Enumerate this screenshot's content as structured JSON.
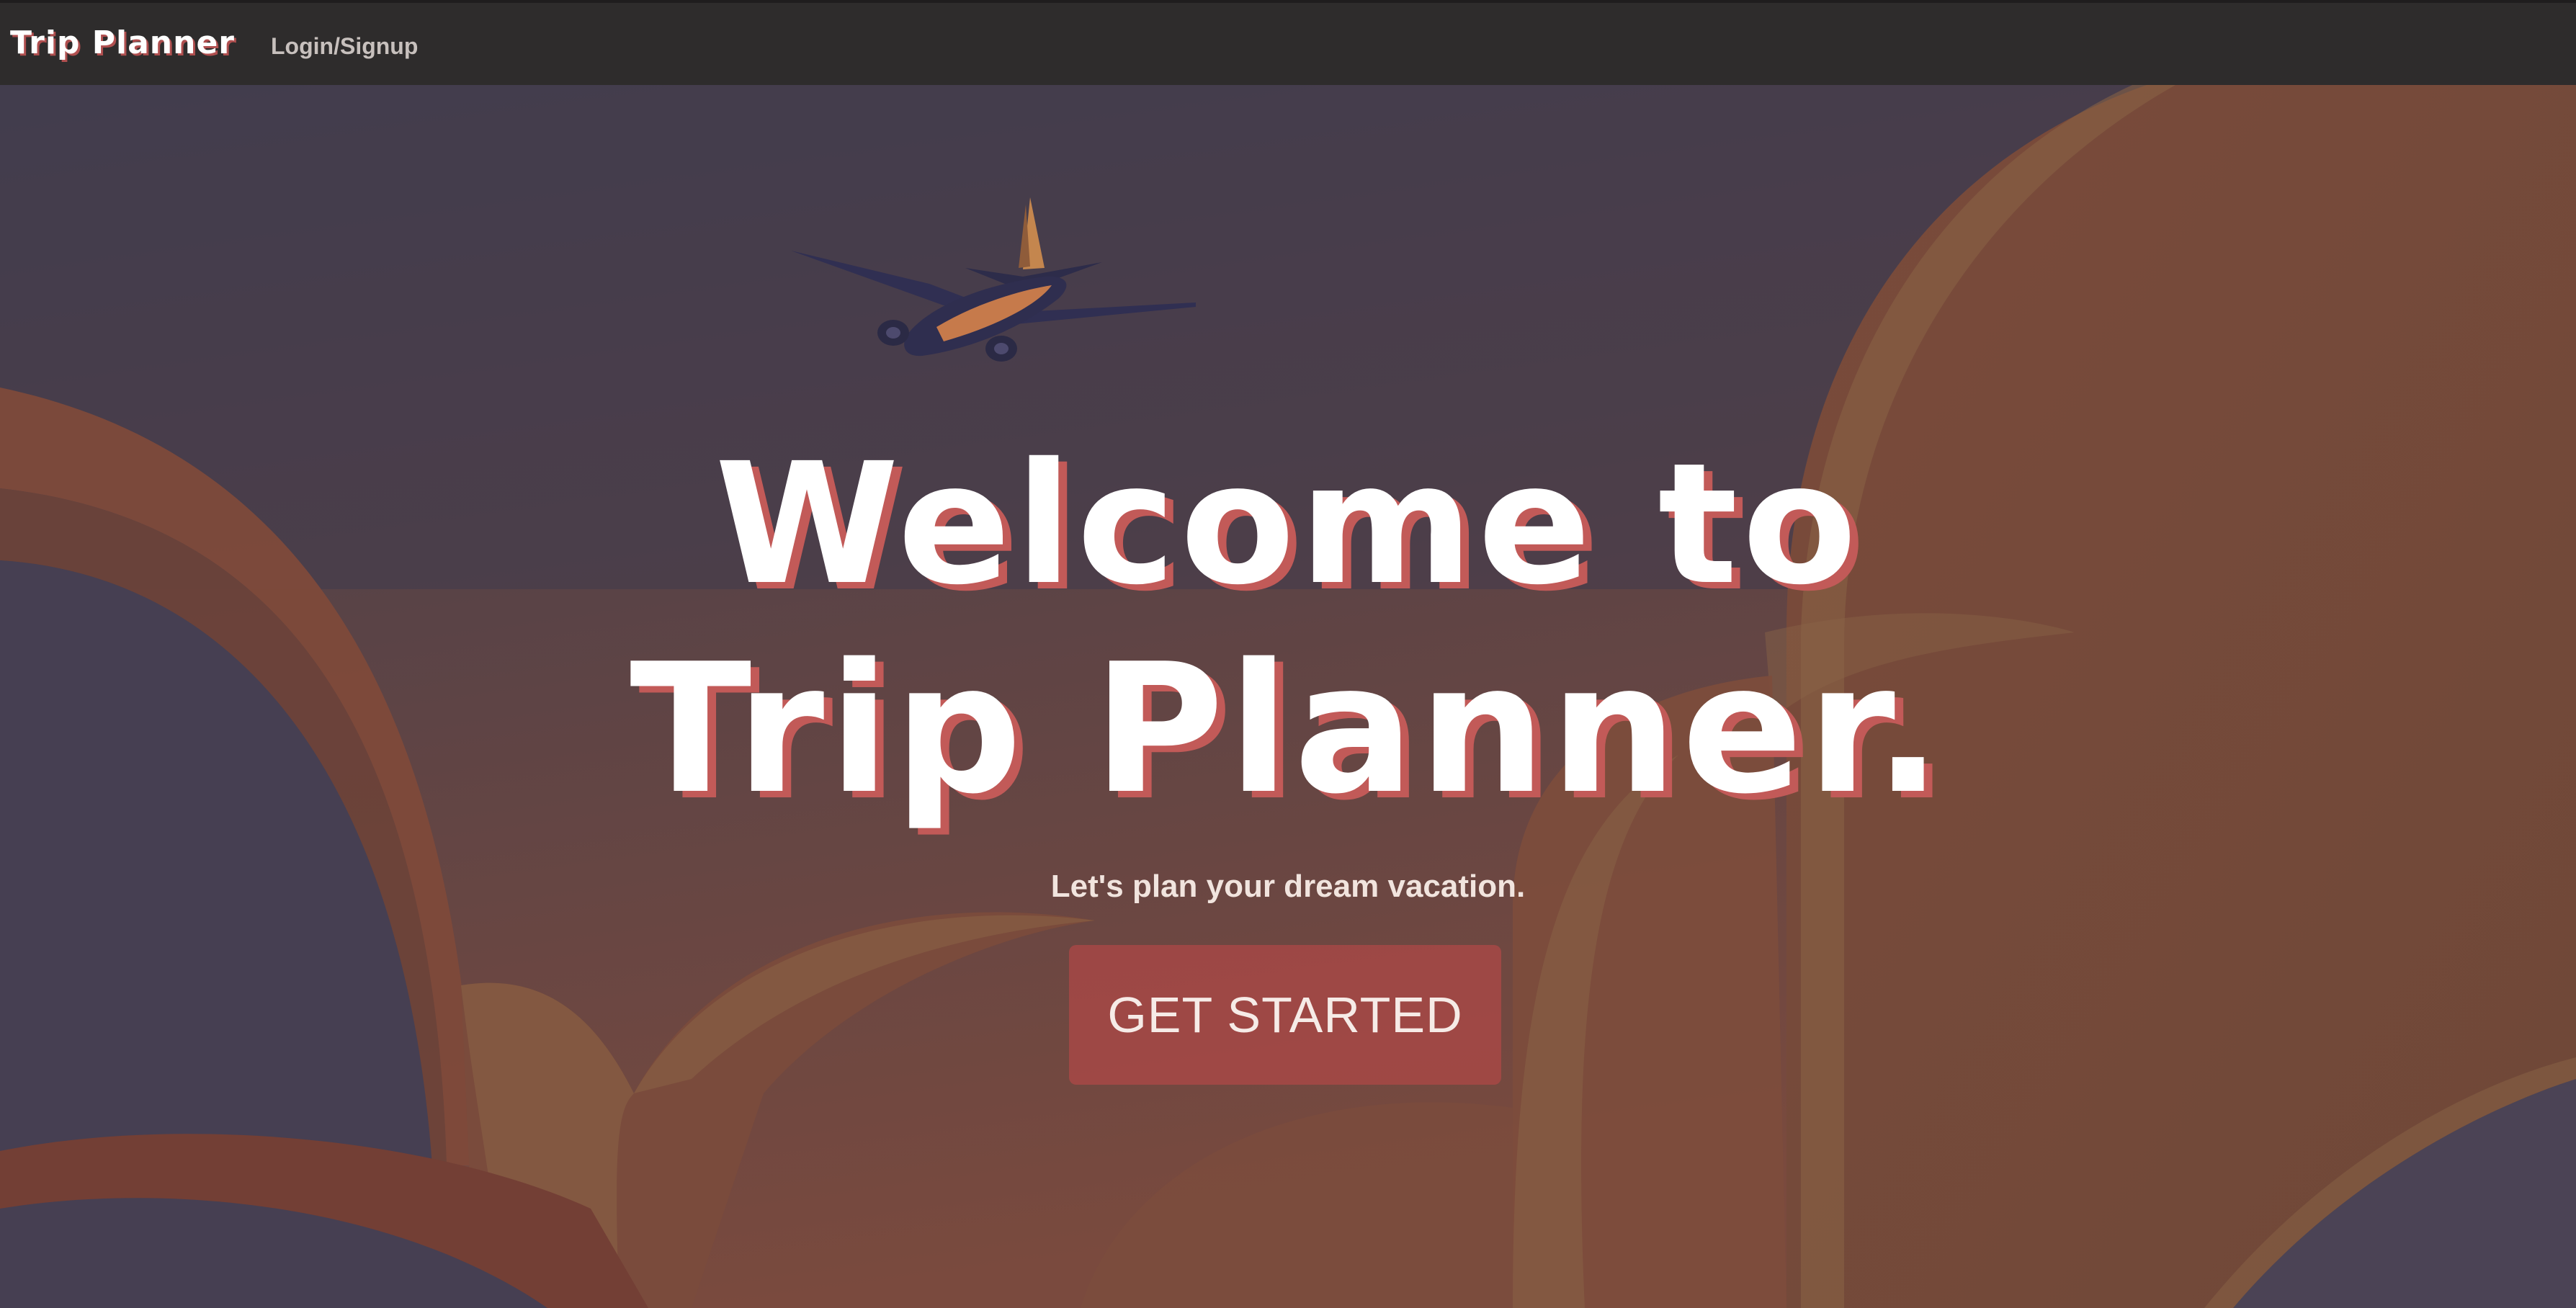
{
  "nav": {
    "brand": "Trip Planner",
    "login_link": "Login/Signup"
  },
  "hero": {
    "headline_line1": "Welcome to",
    "headline_line2": "Trip Planner.",
    "tagline": "Let's plan your dream vacation.",
    "cta_label": "GET STARTED",
    "illustration": "airplane-icon"
  },
  "colors": {
    "navbar": "#2e2c2c",
    "accent": "#c25a58",
    "button": "#b04846",
    "sky_dark": "#3e3a4e",
    "cloud_orange": "#8a4c3a"
  }
}
